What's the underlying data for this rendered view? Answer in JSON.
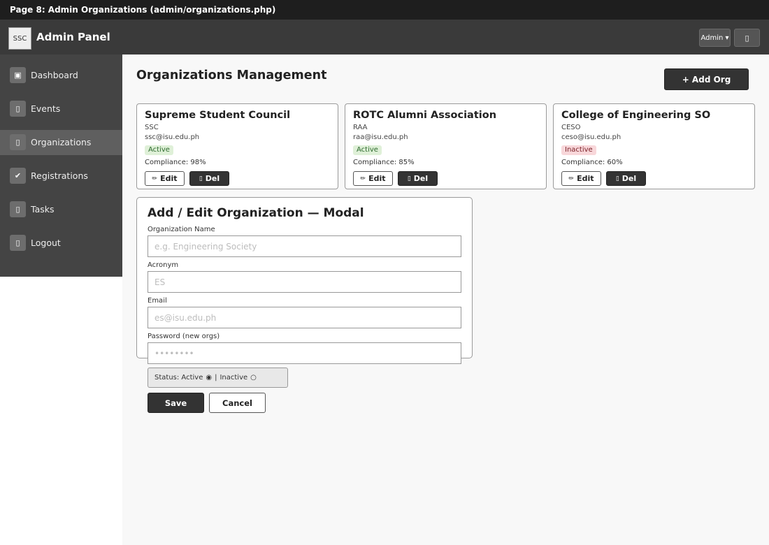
{
  "page_caption": "Page 8: Admin Organizations (admin/organizations.php)",
  "header": {
    "logo_text": "SSC",
    "app_title": "Admin Panel",
    "admin_dropdown": "Admin ▾",
    "icon_button_glyph": "▯"
  },
  "sidebar": {
    "items": [
      {
        "label": "Dashboard",
        "icon": "dashboard-icon",
        "glyph": "▣"
      },
      {
        "label": "Events",
        "icon": "events-icon",
        "glyph": "▯"
      },
      {
        "label": "Organizations",
        "icon": "organizations-icon",
        "glyph": "▯"
      },
      {
        "label": "Registrations",
        "icon": "registrations-icon",
        "glyph": "✔"
      },
      {
        "label": "Tasks",
        "icon": "tasks-icon",
        "glyph": "▯"
      },
      {
        "label": "Logout",
        "icon": "logout-icon",
        "glyph": "▯"
      }
    ],
    "active": "Organizations"
  },
  "main": {
    "title": "Organizations Management",
    "add_button": "+ Add Org",
    "orgs": [
      {
        "name": "Supreme Student Council",
        "acronym": "SSC",
        "email": "ssc@isu.edu.ph",
        "status": "Active",
        "compliance": "Compliance: 98%"
      },
      {
        "name": "ROTC Alumni Association",
        "acronym": "RAA",
        "email": "raa@isu.edu.ph",
        "status": "Active",
        "compliance": "Compliance: 85%"
      },
      {
        "name": "College of Engineering SO",
        "acronym": "CESO",
        "email": "ceso@isu.edu.ph",
        "status": "Inactive",
        "compliance": "Compliance: 60%"
      }
    ],
    "card_buttons": {
      "edit": "Edit",
      "edit_glyph": "✏",
      "del": "Del",
      "del_glyph": "▯"
    }
  },
  "modal": {
    "title": "Add / Edit Organization — Modal",
    "fields": [
      {
        "label": "Organization Name",
        "placeholder": "e.g. Engineering Society",
        "value": ""
      },
      {
        "label": "Acronym",
        "placeholder": "ES",
        "value": ""
      },
      {
        "label": "Email",
        "placeholder": "es@isu.edu.ph",
        "value": ""
      },
      {
        "label": "Password (new orgs)",
        "placeholder": "••••••••",
        "value": ""
      }
    ],
    "status": {
      "prefix": "Status: Active",
      "selected_glyph": "◉",
      "separator": "|",
      "inactive_label": "Inactive",
      "unselected_glyph": "○",
      "selected": "Active"
    },
    "save": "Save",
    "cancel": "Cancel"
  },
  "colors": {
    "header_bg": "#3a3a3a",
    "sidebar_bg": "#444444",
    "active_badge_bg": "#dff0d8",
    "inactive_badge_bg": "#f8d7da",
    "primary_button": "#333333"
  }
}
